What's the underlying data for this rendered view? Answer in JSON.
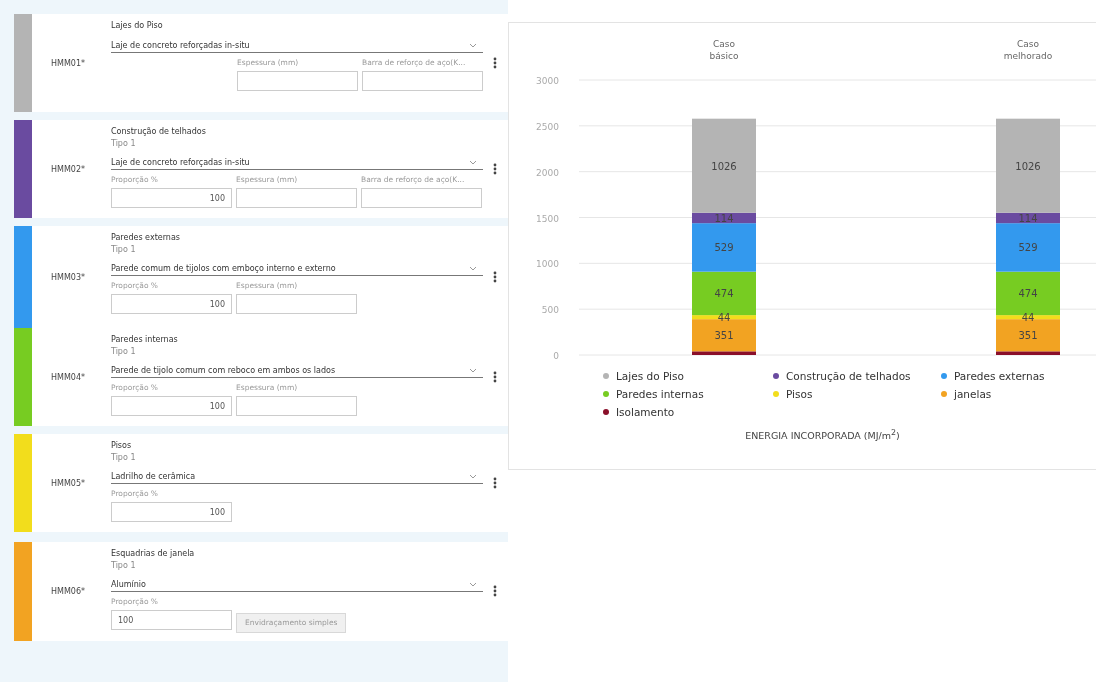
{
  "elements": [
    {
      "code": "HMM01*",
      "color": "#b4b4b4",
      "title": "Lajes do Piso",
      "material": "Laje de concreto reforçadas in-situ",
      "fields": [
        {
          "kind": "input",
          "label": "Espessura (mm)"
        },
        {
          "kind": "input",
          "label": "Barra de reforço de aço(K..."
        }
      ]
    },
    {
      "code": "HMM02*",
      "color": "#6a4ba0",
      "title": "Construção de telhados",
      "subtitle": "Tipo 1",
      "material": "Laje de concreto reforçadas in-situ",
      "fields": [
        {
          "kind": "input",
          "label": "Proporção %",
          "value": "100"
        },
        {
          "kind": "input",
          "label": "Espessura (mm)"
        },
        {
          "kind": "input",
          "label": "Barra de reforço de aço(K..."
        }
      ]
    },
    {
      "code": "HMM03*",
      "color": "#3399ee",
      "title": "Paredes externas",
      "subtitle": "Tipo 1",
      "material": "Parede comum de tijolos com emboço interno e externo",
      "fields": [
        {
          "kind": "input",
          "label": "Proporção %",
          "value": "100"
        },
        {
          "kind": "input",
          "label": "Espessura (mm)"
        }
      ]
    },
    {
      "code": "HMM04*",
      "color": "#77cc22",
      "title": "Paredes internas",
      "subtitle": "Tipo 1",
      "material": "Parede de tijolo comum com reboco em ambos os lados",
      "fields": [
        {
          "kind": "input",
          "label": "Proporção %",
          "value": "100"
        },
        {
          "kind": "input",
          "label": "Espessura (mm)"
        }
      ]
    },
    {
      "code": "HMM05*",
      "color": "#f2dd1c",
      "title": "Pisos",
      "subtitle": "Tipo 1",
      "material": "Ladrilho de cerâmica",
      "fields": [
        {
          "kind": "input",
          "label": "Proporção %",
          "value": "100"
        }
      ]
    },
    {
      "code": "HMM06*",
      "color": "#f2a322",
      "title": "Esquadrias de janela",
      "subtitle": "Tipo 1",
      "material": "Alumínio",
      "fields": [
        {
          "kind": "text",
          "label": "Proporção %",
          "value": "100"
        },
        {
          "kind": "button",
          "value": "Envidraçamento simples"
        }
      ]
    }
  ],
  "chart": {
    "chart_data": {
      "type": "bar",
      "stacked": true,
      "grid": true,
      "title": "ENERGIA INCORPORADA (MJ/m$^{2}$)",
      "categories": [
        "Caso\nbásico",
        "Caso\nmelhorado"
      ],
      "ylim": [
        0,
        3000
      ],
      "yticks": [
        0,
        500,
        1000,
        1500,
        2000,
        2500,
        3000
      ],
      "series": [
        {
          "name": "Lajes do Piso",
          "color": "#b4b4b4",
          "values": [
            1026,
            1026
          ],
          "data_labels": true
        },
        {
          "name": "Construção de telhados",
          "color": "#6a4ba0",
          "values": [
            114,
            114
          ],
          "data_labels": true
        },
        {
          "name": "Paredes externas",
          "color": "#3399ee",
          "values": [
            529,
            529
          ],
          "data_labels": true
        },
        {
          "name": "Paredes internas",
          "color": "#77cc22",
          "values": [
            474,
            474
          ],
          "data_labels": true
        },
        {
          "name": "Pisos",
          "color": "#f2dd1c",
          "values": [
            44,
            44
          ],
          "data_labels": true
        },
        {
          "name": "janelas",
          "color": "#f2a322",
          "values": [
            351,
            351
          ],
          "data_labels": true
        },
        {
          "name": "Isolamento",
          "color": "#8a0f2a",
          "values": [
            40,
            40
          ],
          "data_labels": false
        }
      ]
    }
  }
}
